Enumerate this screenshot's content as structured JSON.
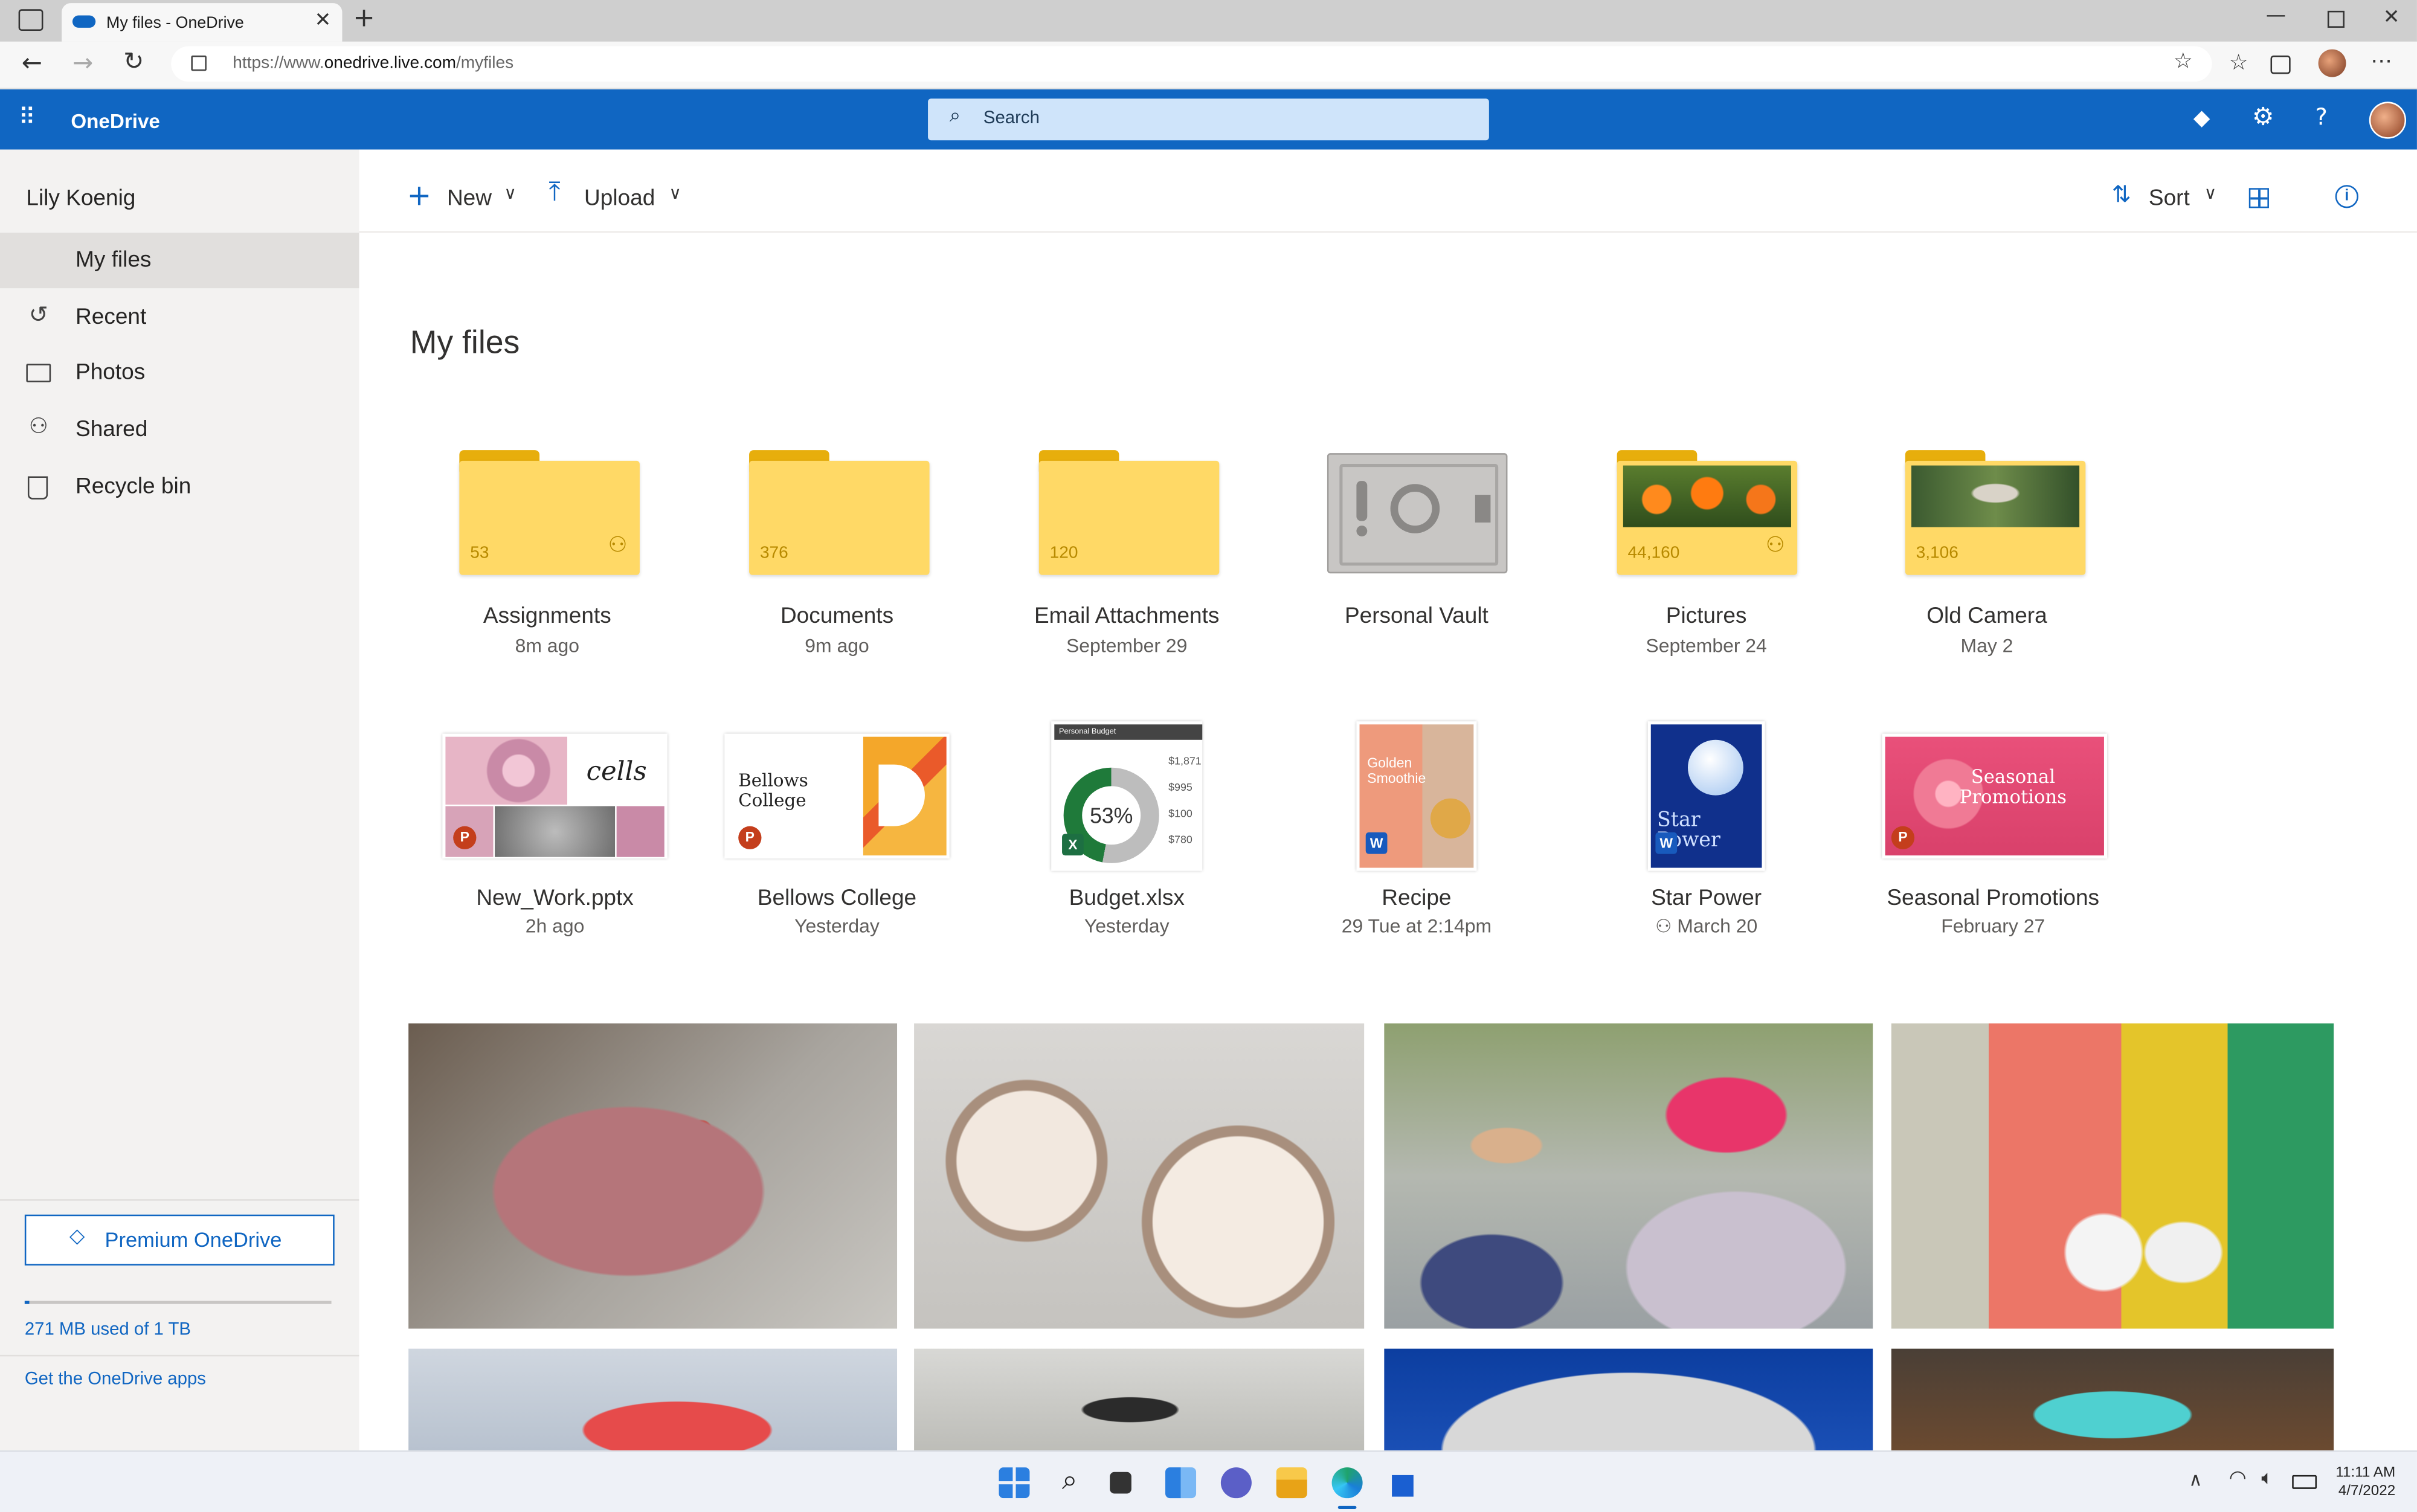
{
  "browser": {
    "tab_title": "My files - OneDrive",
    "url_prefix": "https://www.",
    "url_domain": "onedrive.live.com",
    "url_path": "/myfiles"
  },
  "header": {
    "app_name": "OneDrive",
    "search_placeholder": "Search"
  },
  "sidebar": {
    "user_name": "Lily Koenig",
    "items": [
      {
        "label": "My files",
        "icon": "none",
        "selected": true
      },
      {
        "label": "Recent",
        "icon": "history-icon"
      },
      {
        "label": "Photos",
        "icon": "photos-icon"
      },
      {
        "label": "Shared",
        "icon": "people-icon"
      },
      {
        "label": "Recycle bin",
        "icon": "recycle-bin-icon"
      }
    ],
    "premium_label": "Premium OneDrive",
    "storage_text": "271 MB used of 1 TB",
    "storage_fraction": 0.0003,
    "get_apps": "Get the OneDrive apps"
  },
  "command_bar": {
    "new_label": "New",
    "upload_label": "Upload",
    "sort_label": "Sort"
  },
  "main": {
    "title": "My files",
    "folders": [
      {
        "name": "Assignments",
        "modified": "8m ago",
        "count": "53",
        "shared": true
      },
      {
        "name": "Documents",
        "modified": "9m ago",
        "count": "376",
        "shared": false
      },
      {
        "name": "Email Attachments",
        "modified": "September 29",
        "count": "120",
        "shared": false
      },
      {
        "name": "Personal Vault",
        "modified": ""
      },
      {
        "name": "Pictures",
        "modified": "September 24",
        "count": "44,160",
        "shared": true
      },
      {
        "name": "Old Camera",
        "modified": "May 2",
        "count": "3,106",
        "shared": false
      }
    ],
    "files": [
      {
        "name": "New_Work.pptx",
        "modified": "2h ago",
        "thumb_text": "cells"
      },
      {
        "name": "Bellows College",
        "modified": "Yesterday",
        "thumb_text": "Bellows College"
      },
      {
        "name": "Budget.xlsx",
        "modified": "Yesterday",
        "thumb_text": "Personal Budget",
        "thumb_percent": "53%",
        "thumb_values": [
          "$1,871",
          "$995",
          "$100",
          "$780"
        ]
      },
      {
        "name": "Recipe",
        "modified": "29 Tue at 2:14pm",
        "thumb_text": "Golden Smoothie"
      },
      {
        "name": "Star Power",
        "modified": "March 20",
        "shared": true,
        "thumb_text": "Star Power"
      },
      {
        "name": "Seasonal Promotions",
        "modified": "February 27",
        "thumb_text": "Seasonal Promotions"
      }
    ]
  },
  "taskbar": {
    "time": "11:11 AM",
    "date": "4/7/2022"
  }
}
